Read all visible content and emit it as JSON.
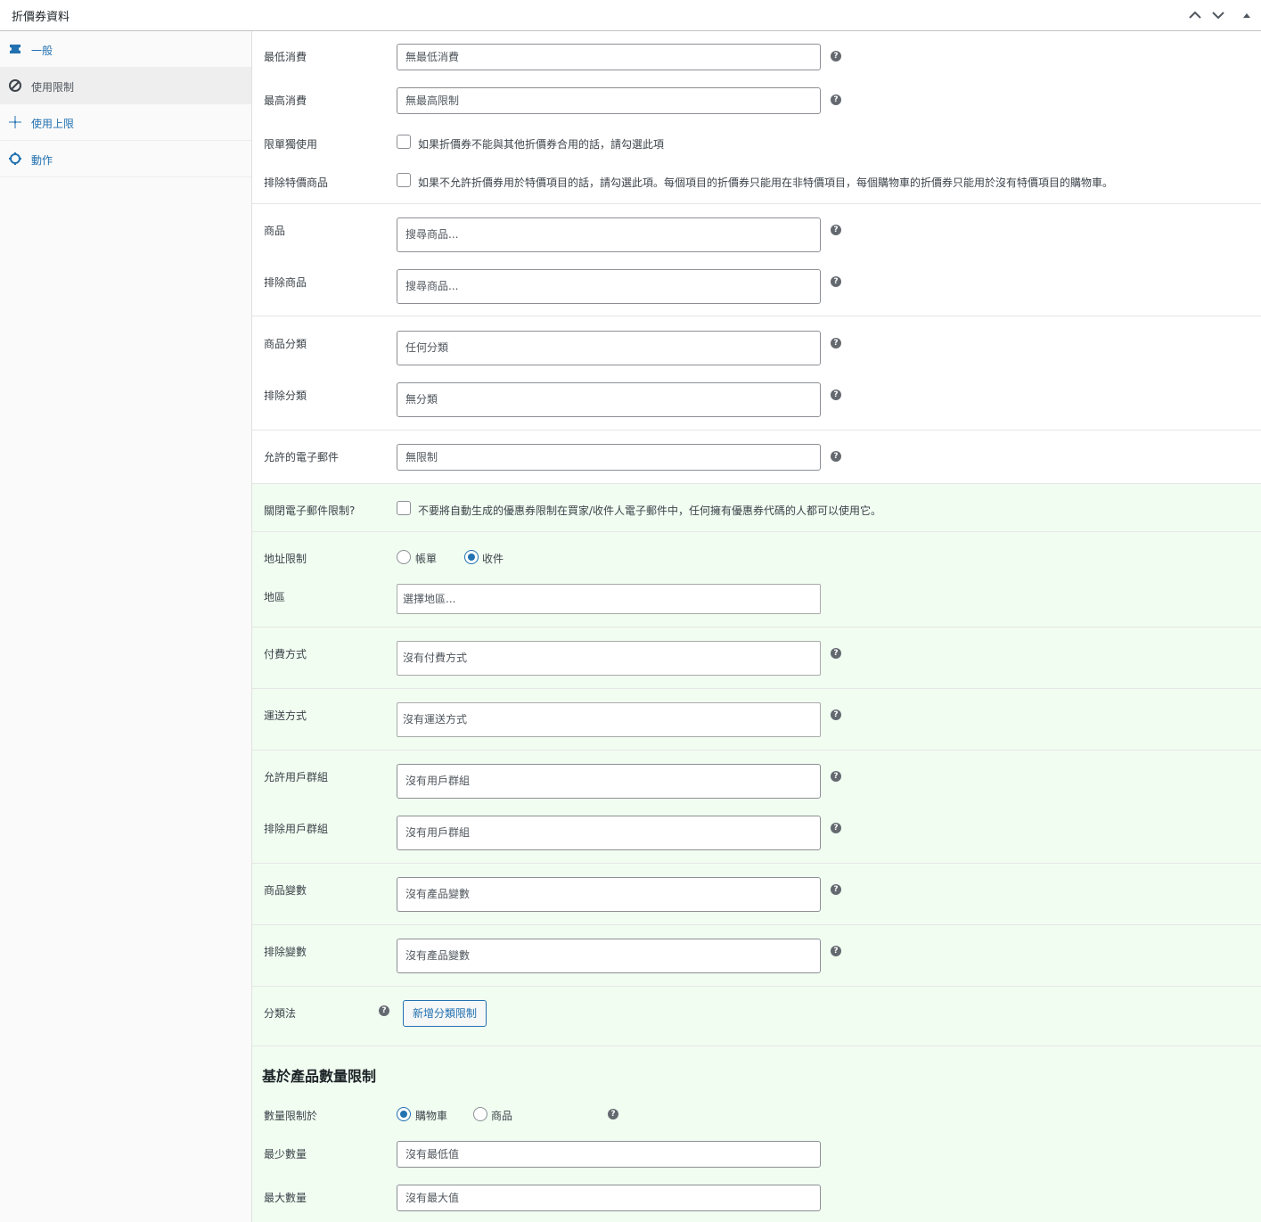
{
  "panel": {
    "title": "折價券資料"
  },
  "sidebar": {
    "tabs": [
      {
        "label": "一般",
        "icon": "ticket-icon"
      },
      {
        "label": "使用限制",
        "icon": "block-icon"
      },
      {
        "label": "使用上限",
        "icon": "sparkle-icon"
      },
      {
        "label": "動作",
        "icon": "cog-icon"
      }
    ],
    "active_tab": "使用限制"
  },
  "form": {
    "min_spend": {
      "label": "最低消費",
      "placeholder": "無最低消費"
    },
    "max_spend": {
      "label": "最高消費",
      "placeholder": "無最高限制"
    },
    "individual_use": {
      "label": "限單獨使用",
      "description": "如果折價券不能與其他折價券合用的話，請勾選此項",
      "checked": false
    },
    "exclude_sale_items": {
      "label": "排除特價商品",
      "description": "如果不允許折價券用於特價項目的話，請勾選此項。每個項目的折價券只能用在非特價項目，每個購物車的折價券只能用於沒有特價項目的購物車。",
      "checked": false
    },
    "products": {
      "label": "商品",
      "placeholder": "搜尋商品..."
    },
    "exclude_products": {
      "label": "排除商品",
      "placeholder": "搜尋商品..."
    },
    "product_categories": {
      "label": "商品分類",
      "placeholder": "任何分類"
    },
    "exclude_categories": {
      "label": "排除分類",
      "placeholder": "無分類"
    },
    "allowed_emails": {
      "label": "允許的電子郵件",
      "placeholder": "無限制"
    },
    "disable_email_restriction": {
      "label": "關閉電子郵件限制?",
      "description": "不要將自動生成的優惠券限制在買家/收件人電子郵件中，任何擁有優惠券代碼的人都可以使用它。",
      "checked": false
    },
    "address_restriction": {
      "label": "地址限制",
      "options": [
        "帳單",
        "收件"
      ],
      "selected": "收件"
    },
    "region": {
      "label": "地區",
      "placeholder": "選擇地區..."
    },
    "payment_methods": {
      "label": "付費方式",
      "placeholder": "沒有付費方式"
    },
    "shipping_methods": {
      "label": "運送方式",
      "placeholder": "沒有運送方式"
    },
    "allowed_user_groups": {
      "label": "允許用戶群組",
      "placeholder": "沒有用戶群組"
    },
    "exclude_user_groups": {
      "label": "排除用戶群組",
      "placeholder": "沒有用戶群組"
    },
    "product_variations": {
      "label": "商品變數",
      "placeholder": "沒有產品變數"
    },
    "exclude_variations": {
      "label": "排除變數",
      "placeholder": "沒有產品變數"
    },
    "taxonomy": {
      "label": "分類法",
      "button": "新增分類限制"
    }
  },
  "quantity_section": {
    "title": "基於產品數量限制",
    "limit_on": {
      "label": "數量限制於",
      "options": [
        "購物車",
        "商品"
      ],
      "selected": "購物車"
    },
    "min_quantity": {
      "label": "最少數量",
      "placeholder": "沒有最低值"
    },
    "max_quantity": {
      "label": "最大數量",
      "placeholder": "沒有最大值"
    }
  },
  "colors": {
    "accent": "#2271b1",
    "green_background": "#f1fdf1",
    "sidebar_background": "#fafafa"
  }
}
